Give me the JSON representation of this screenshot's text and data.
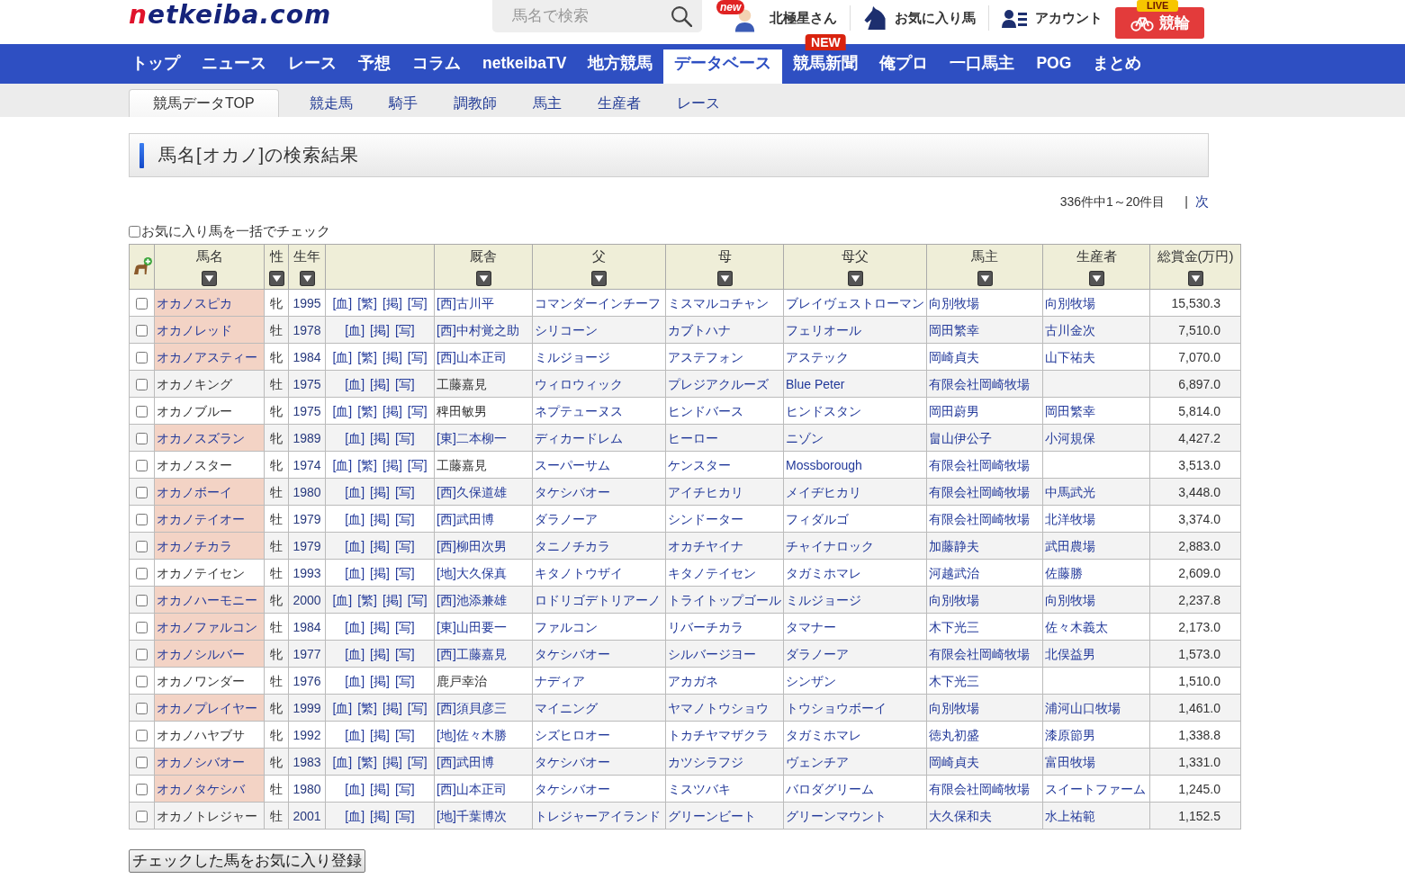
{
  "header": {
    "logo": "netkeiba.com",
    "search": {
      "placeholder": "馬名で検索"
    },
    "user": {
      "badge": "new",
      "name": "北極星さん"
    },
    "links": [
      {
        "kind": "favorites",
        "label": "お気に入り馬"
      },
      {
        "kind": "account",
        "label": "アカウント"
      }
    ],
    "keirin": {
      "label": "競輪",
      "badge": "LIVE"
    }
  },
  "nav": [
    {
      "label": "トップ",
      "selected": false
    },
    {
      "label": "ニュース",
      "selected": false
    },
    {
      "label": "レース",
      "selected": false
    },
    {
      "label": "予想",
      "selected": false
    },
    {
      "label": "コラム",
      "selected": false
    },
    {
      "label": "netkeibaTV",
      "selected": false
    },
    {
      "label": "地方競馬",
      "selected": false
    },
    {
      "label": "データベース",
      "selected": true
    },
    {
      "label": "競馬新聞",
      "selected": false,
      "badge": "NEW"
    },
    {
      "label": "俺プロ",
      "selected": false
    },
    {
      "label": "一口馬主",
      "selected": false
    },
    {
      "label": "POG",
      "selected": false
    },
    {
      "label": "まとめ",
      "selected": false
    }
  ],
  "subnav": [
    {
      "label": "競馬データTOP",
      "selected": true
    },
    {
      "label": "競走馬",
      "selected": false
    },
    {
      "label": "騎手",
      "selected": false
    },
    {
      "label": "調教師",
      "selected": false
    },
    {
      "label": "馬主",
      "selected": false
    },
    {
      "label": "生産者",
      "selected": false
    },
    {
      "label": "レース",
      "selected": false
    }
  ],
  "title": "馬名[オカノ]の検索結果",
  "pager": {
    "summary": "336件中1～20件目",
    "separator": "|",
    "next": "次"
  },
  "bulk_check": {
    "label": "お気に入り馬を一括でチェック",
    "checked": false
  },
  "table": {
    "columns": [
      {
        "kind": "favorite"
      },
      {
        "kind": "sortable",
        "label": "馬名"
      },
      {
        "kind": "sortable",
        "label": "性"
      },
      {
        "kind": "sortable",
        "label": "生年"
      },
      {
        "kind": "blank"
      },
      {
        "kind": "sortable",
        "label": "厩舎"
      },
      {
        "kind": "sortable",
        "label": "父"
      },
      {
        "kind": "sortable",
        "label": "母"
      },
      {
        "kind": "sortable",
        "label": "母父"
      },
      {
        "kind": "sortable",
        "label": "馬主"
      },
      {
        "kind": "sortable",
        "label": "生産者"
      },
      {
        "kind": "sortable",
        "label": "総賞金(万円)"
      }
    ],
    "rows": [
      {
        "checked": false,
        "name": "オカノスピカ",
        "highlighted": true,
        "sex": "牝",
        "year": "1995",
        "links": [
          "[血]",
          "[繁]",
          "[掲]",
          "[写]"
        ],
        "trainer": "[西]古川平",
        "trainer_linked": true,
        "sire": "コマンダーインチーフ",
        "dam": "ミスマルコチャン",
        "broodmare_sire": "ブレイヴェストローマン",
        "owner": "向別牧場",
        "breeder": "向別牧場",
        "prize": "15,530.3"
      },
      {
        "checked": false,
        "name": "オカノレッド",
        "highlighted": true,
        "sex": "牡",
        "year": "1978",
        "links": [
          "[血]",
          "[掲]",
          "[写]"
        ],
        "trainer": "[西]中村覚之助",
        "trainer_linked": true,
        "sire": "シリコーン",
        "dam": "カブトハナ",
        "broodmare_sire": "フェリオール",
        "owner": "岡田繁幸",
        "breeder": "古川金次",
        "prize": "7,510.0"
      },
      {
        "checked": false,
        "name": "オカノアスティー",
        "highlighted": true,
        "sex": "牝",
        "year": "1984",
        "links": [
          "[血]",
          "[繁]",
          "[掲]",
          "[写]"
        ],
        "trainer": "[西]山本正司",
        "trainer_linked": true,
        "sire": "ミルジョージ",
        "dam": "アステフォン",
        "broodmare_sire": "アステック",
        "owner": "岡崎貞夫",
        "breeder": "山下祐夫",
        "prize": "7,070.0"
      },
      {
        "checked": false,
        "name": "オカノキング",
        "highlighted": false,
        "sex": "牡",
        "year": "1975",
        "links": [
          "[血]",
          "[掲]",
          "[写]"
        ],
        "trainer": "工藤嘉見",
        "trainer_linked": false,
        "sire": "ウィロウィック",
        "dam": "プレジアクルーズ",
        "broodmare_sire": "Blue Peter",
        "owner": "有限会社岡崎牧場",
        "prize": "6,897.0"
      },
      {
        "checked": false,
        "name": "オカノブルー",
        "highlighted": false,
        "sex": "牝",
        "year": "1975",
        "links": [
          "[血]",
          "[繁]",
          "[掲]",
          "[写]"
        ],
        "trainer": "稗田敏男",
        "trainer_linked": false,
        "sire": "ネプテューヌス",
        "dam": "ヒンドバース",
        "broodmare_sire": "ヒンドスタン",
        "owner": "岡田蔚男",
        "breeder": "岡田繁幸",
        "prize": "5,814.0"
      },
      {
        "checked": false,
        "name": "オカノスズラン",
        "highlighted": true,
        "sex": "牝",
        "year": "1989",
        "links": [
          "[血]",
          "[掲]",
          "[写]"
        ],
        "trainer": "[東]二本柳一",
        "trainer_linked": true,
        "sire": "ディカードレム",
        "dam": "ヒーロー",
        "broodmare_sire": "ニゾン",
        "owner": "畠山伊公子",
        "breeder": "小河規保",
        "prize": "4,427.2"
      },
      {
        "checked": false,
        "name": "オカノスター",
        "highlighted": false,
        "sex": "牝",
        "year": "1974",
        "links": [
          "[血]",
          "[繁]",
          "[掲]",
          "[写]"
        ],
        "trainer": "工藤嘉見",
        "trainer_linked": false,
        "sire": "スーパーサム",
        "dam": "ケンスター",
        "broodmare_sire": "Mossborough",
        "owner": "有限会社岡崎牧場",
        "prize": "3,513.0"
      },
      {
        "checked": false,
        "name": "オカノボーイ",
        "highlighted": true,
        "sex": "牡",
        "year": "1980",
        "links": [
          "[血]",
          "[掲]",
          "[写]"
        ],
        "trainer": "[西]久保道雄",
        "trainer_linked": true,
        "sire": "タケシバオー",
        "dam": "アイチヒカリ",
        "broodmare_sire": "メイヂヒカリ",
        "owner": "有限会社岡崎牧場",
        "breeder": "中馬武光",
        "prize": "3,448.0"
      },
      {
        "checked": false,
        "name": "オカノテイオー",
        "highlighted": true,
        "sex": "牡",
        "year": "1979",
        "links": [
          "[血]",
          "[掲]",
          "[写]"
        ],
        "trainer": "[西]武田博",
        "trainer_linked": true,
        "sire": "ダラノーア",
        "dam": "シンドーター",
        "broodmare_sire": "フィダルゴ",
        "owner": "有限会社岡崎牧場",
        "breeder": "北洋牧場",
        "prize": "3,374.0"
      },
      {
        "checked": false,
        "name": "オカノチカラ",
        "highlighted": true,
        "sex": "牡",
        "year": "1979",
        "links": [
          "[血]",
          "[掲]",
          "[写]"
        ],
        "trainer": "[西]柳田次男",
        "trainer_linked": true,
        "sire": "タニノチカラ",
        "dam": "オカチヤイナ",
        "broodmare_sire": "チャイナロック",
        "owner": "加藤静夫",
        "breeder": "武田農場",
        "prize": "2,883.0"
      },
      {
        "checked": false,
        "name": "オカノテイセン",
        "highlighted": false,
        "sex": "牡",
        "year": "1993",
        "links": [
          "[血]",
          "[掲]",
          "[写]"
        ],
        "trainer": "[地]大久保真",
        "trainer_linked": true,
        "sire": "キタノトウザイ",
        "dam": "キタノテイセン",
        "broodmare_sire": "タガミホマレ",
        "owner": "河越武治",
        "breeder": "佐藤勝",
        "prize": "2,609.0"
      },
      {
        "checked": false,
        "name": "オカノハーモニー",
        "highlighted": true,
        "sex": "牝",
        "year": "2000",
        "links": [
          "[血]",
          "[繁]",
          "[掲]",
          "[写]"
        ],
        "trainer": "[西]池添兼雄",
        "trainer_linked": true,
        "sire": "ロドリゴデトリアーノ",
        "dam": "トライトップゴール",
        "broodmare_sire": "ミルジョージ",
        "owner": "向別牧場",
        "breeder": "向別牧場",
        "prize": "2,237.8"
      },
      {
        "checked": false,
        "name": "オカノファルコン",
        "highlighted": true,
        "sex": "牡",
        "year": "1984",
        "links": [
          "[血]",
          "[掲]",
          "[写]"
        ],
        "trainer": "[東]山田要一",
        "trainer_linked": true,
        "sire": "ファルコン",
        "dam": "リバーチカラ",
        "broodmare_sire": "タマナー",
        "owner": "木下光三",
        "breeder": "佐々木義太",
        "prize": "2,173.0"
      },
      {
        "checked": false,
        "name": "オカノシルバー",
        "highlighted": true,
        "sex": "牝",
        "year": "1977",
        "links": [
          "[血]",
          "[掲]",
          "[写]"
        ],
        "trainer": "[西]工藤嘉見",
        "trainer_linked": true,
        "sire": "タケシバオー",
        "dam": "シルバージヨー",
        "broodmare_sire": "ダラノーア",
        "owner": "有限会社岡崎牧場",
        "breeder": "北俣益男",
        "prize": "1,573.0"
      },
      {
        "checked": false,
        "name": "オカノワンダー",
        "highlighted": false,
        "sex": "牡",
        "year": "1976",
        "links": [
          "[血]",
          "[掲]",
          "[写]"
        ],
        "trainer": "鹿戸幸治",
        "trainer_linked": false,
        "sire": "ナディア",
        "dam": "アカガネ",
        "broodmare_sire": "シンザン",
        "owner": "木下光三",
        "prize": "1,510.0"
      },
      {
        "checked": false,
        "name": "オカノプレイヤー",
        "highlighted": true,
        "sex": "牝",
        "year": "1999",
        "links": [
          "[血]",
          "[繁]",
          "[掲]",
          "[写]"
        ],
        "trainer": "[西]須貝彦三",
        "trainer_linked": true,
        "sire": "マイニング",
        "dam": "ヤマノトウショウ",
        "broodmare_sire": "トウショウボーイ",
        "owner": "向別牧場",
        "breeder": "浦河山口牧場",
        "prize": "1,461.0"
      },
      {
        "checked": false,
        "name": "オカノハヤブサ",
        "highlighted": false,
        "sex": "牝",
        "year": "1992",
        "links": [
          "[血]",
          "[掲]",
          "[写]"
        ],
        "trainer": "[地]佐々木勝",
        "trainer_linked": true,
        "sire": "シズヒロオー",
        "dam": "トカチヤマザクラ",
        "broodmare_sire": "タガミホマレ",
        "owner": "徳丸初盛",
        "breeder": "漆原節男",
        "prize": "1,338.8"
      },
      {
        "checked": false,
        "name": "オカノシバオー",
        "highlighted": true,
        "sex": "牝",
        "year": "1983",
        "links": [
          "[血]",
          "[繁]",
          "[掲]",
          "[写]"
        ],
        "trainer": "[西]武田博",
        "trainer_linked": true,
        "sire": "タケシバオー",
        "dam": "カツシラフジ",
        "broodmare_sire": "ヴェンチア",
        "owner": "岡崎貞夫",
        "breeder": "富田牧場",
        "prize": "1,331.0"
      },
      {
        "checked": false,
        "name": "オカノタケシバ",
        "highlighted": true,
        "sex": "牡",
        "year": "1980",
        "links": [
          "[血]",
          "[掲]",
          "[写]"
        ],
        "trainer": "[西]山本正司",
        "trainer_linked": true,
        "sire": "タケシバオー",
        "dam": "ミスツバキ",
        "broodmare_sire": "バロダグリーム",
        "owner": "有限会社岡崎牧場",
        "breeder": "スイートファーム",
        "prize": "1,245.0"
      },
      {
        "checked": false,
        "name": "オカノトレジャー",
        "highlighted": false,
        "sex": "牡",
        "year": "2001",
        "links": [
          "[血]",
          "[掲]",
          "[写]"
        ],
        "trainer": "[地]千葉博次",
        "trainer_linked": true,
        "sire": "トレジャーアイランド",
        "dam": "グリーンビート",
        "broodmare_sire": "グリーンマウント",
        "owner": "大久保和夫",
        "breeder": "水上祐範",
        "prize": "1,152.5"
      }
    ]
  },
  "submit_button": "チェックした馬をお気に入り登録"
}
